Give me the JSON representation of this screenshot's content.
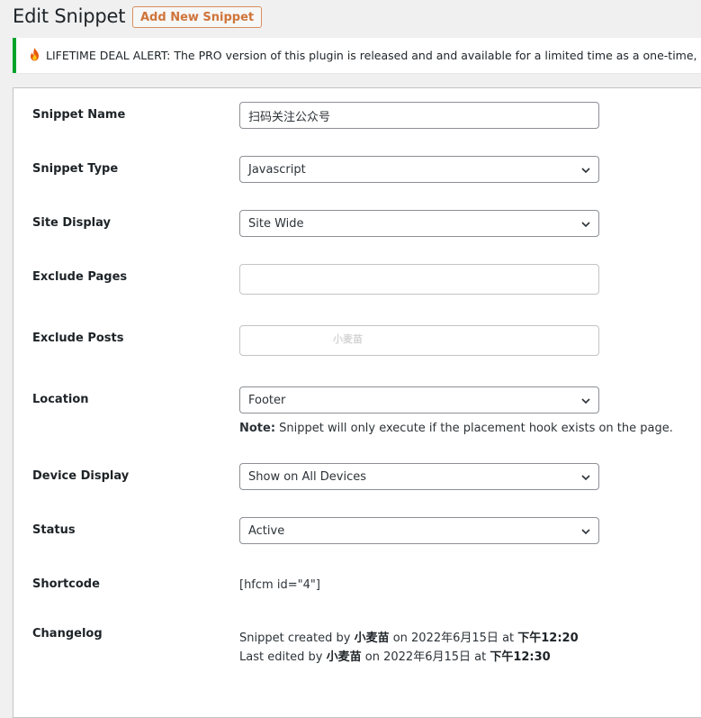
{
  "header": {
    "title": "Edit Snippet",
    "add_new_label": "Add New Snippet"
  },
  "notice": {
    "icon": "fire-icon",
    "text": "LIFETIME DEAL ALERT: The PRO version of this plugin is released and and available for a limited time as a one-time, exclusive lifetime deal.",
    "accent_color": "#00a32a"
  },
  "form": {
    "snippet_name": {
      "label": "Snippet Name",
      "value": "扫码关注公众号"
    },
    "snippet_type": {
      "label": "Snippet Type",
      "value": "Javascript"
    },
    "site_display": {
      "label": "Site Display",
      "value": "Site Wide"
    },
    "exclude_pages": {
      "label": "Exclude Pages",
      "value": ""
    },
    "exclude_posts": {
      "label": "Exclude Posts",
      "value": "",
      "watermark": "小麦苗"
    },
    "location": {
      "label": "Location",
      "value": "Footer",
      "note_prefix": "Note:",
      "note_text": " Snippet will only execute if the placement hook exists on the page."
    },
    "device_display": {
      "label": "Device Display",
      "value": "Show on All Devices"
    },
    "status": {
      "label": "Status",
      "value": "Active"
    },
    "shortcode": {
      "label": "Shortcode",
      "value": "[hfcm id=\"4\"]"
    },
    "changelog": {
      "label": "Changelog",
      "created_prefix": "Snippet created by ",
      "created_by": "小麦苗",
      "created_mid": " on 2022年6月15日 at ",
      "created_time": "下午12:20",
      "edited_prefix": "Last edited by ",
      "edited_by": "小麦苗",
      "edited_mid": " on 2022年6月15日 at ",
      "edited_time": "下午12:30"
    }
  },
  "colors": {
    "accent_orange": "#d0743a",
    "notice_green": "#00a32a",
    "background": "#f0f0f1"
  }
}
